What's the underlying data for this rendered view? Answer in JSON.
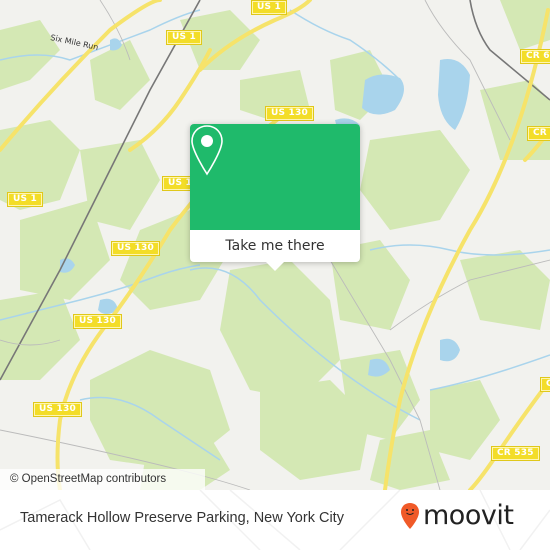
{
  "map": {
    "road_labels": [
      {
        "id": "us1-top",
        "text": "US 1"
      },
      {
        "id": "us1-mid",
        "text": "US 1"
      },
      {
        "id": "us1-left",
        "text": "US 1"
      },
      {
        "id": "us130-a",
        "text": "US 130"
      },
      {
        "id": "us130-b",
        "text": "US 1"
      },
      {
        "id": "us130-c",
        "text": "US 130"
      },
      {
        "id": "us130-d",
        "text": "US 130"
      },
      {
        "id": "us130-e",
        "text": "US 130"
      },
      {
        "id": "cr6",
        "text": "CR 6"
      },
      {
        "id": "cr-right",
        "text": "CR"
      },
      {
        "id": "cr535",
        "text": "CR 535"
      },
      {
        "id": "cr-edge",
        "text": "C"
      }
    ],
    "water_labels": [
      "Six Mile Run"
    ],
    "colors": {
      "land": "#f2f2ee",
      "forest": "#d4e8b4",
      "water": "#a9d4ec",
      "highway": "#f6e36a",
      "shield": "#f3dd28"
    }
  },
  "popup": {
    "icon": "map-pin-icon",
    "button_label": "Take me there",
    "accent_color": "#1fba6b"
  },
  "attribution": "© OpenStreetMap contributors",
  "footer": {
    "place_name": "Tamerack Hollow Preserve Parking, New York City",
    "logo_text": "moovit",
    "logo_color": "#f05a28"
  }
}
